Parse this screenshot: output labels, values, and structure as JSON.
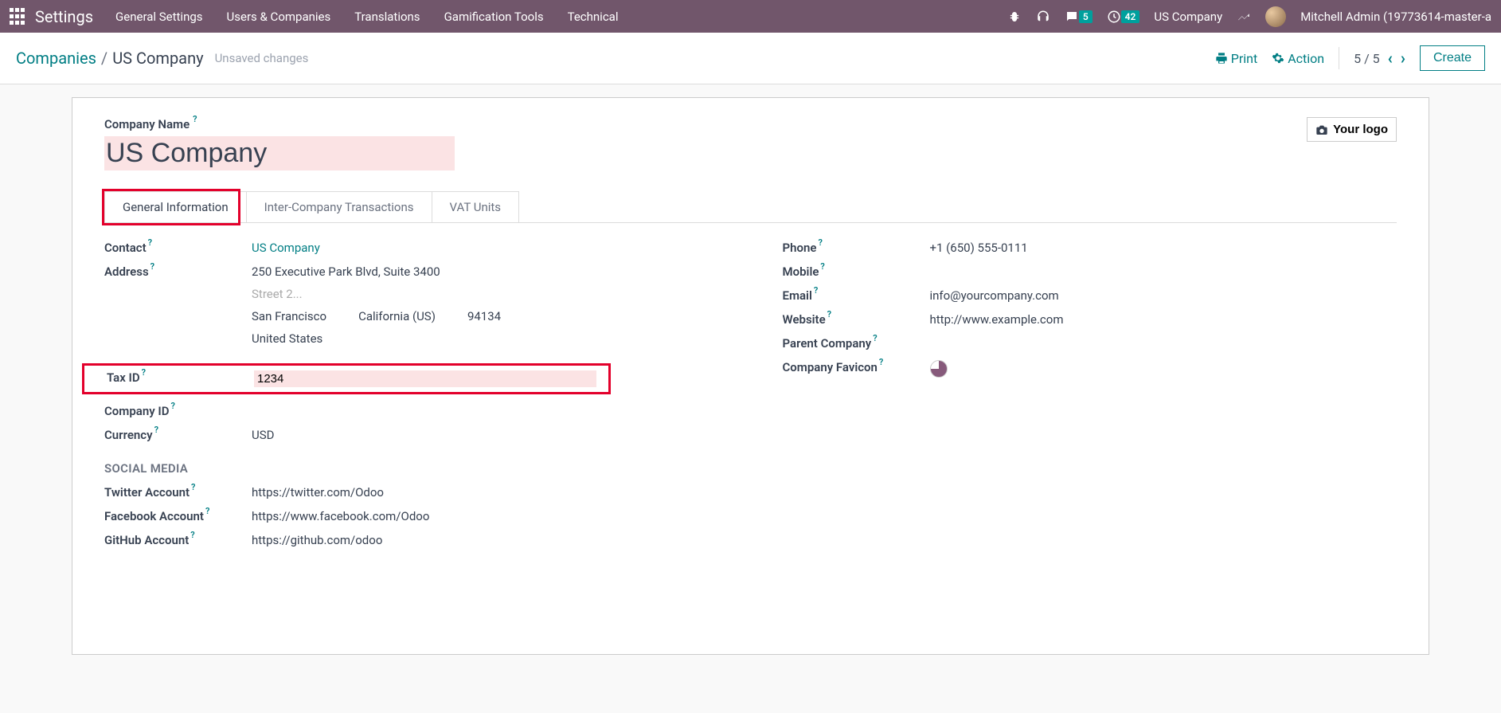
{
  "navbar": {
    "brand": "Settings",
    "menu": [
      "General Settings",
      "Users & Companies",
      "Translations",
      "Gamification Tools",
      "Technical"
    ],
    "msg_badge": "5",
    "clock_badge": "42",
    "company": "US Company",
    "user": "Mitchell Admin (19773614-master-a"
  },
  "controlbar": {
    "breadcrumb_root": "Companies",
    "breadcrumb_sep": "/",
    "breadcrumb_current": "US Company",
    "unsaved": "Unsaved changes",
    "print": "Print",
    "action": "Action",
    "pager": "5 / 5",
    "create": "Create"
  },
  "sheet": {
    "company_name_label": "Company Name",
    "company_name": "US Company",
    "logo_btn": "Your logo",
    "tabs": [
      "General Information",
      "Inter-Company Transactions",
      "VAT Units"
    ],
    "left": {
      "contact_lbl": "Contact",
      "contact_val": "US Company",
      "address_lbl": "Address",
      "street1": "250 Executive Park Blvd, Suite 3400",
      "street2_ph": "Street 2...",
      "city": "San Francisco",
      "state": "California (US)",
      "zip": "94134",
      "country": "United States",
      "taxid_lbl": "Tax ID",
      "taxid_val": "1234",
      "companyid_lbl": "Company ID",
      "currency_lbl": "Currency",
      "currency_val": "USD"
    },
    "right": {
      "phone_lbl": "Phone",
      "phone_val": "+1 (650) 555-0111",
      "mobile_lbl": "Mobile",
      "email_lbl": "Email",
      "email_val": "info@yourcompany.com",
      "website_lbl": "Website",
      "website_val": "http://www.example.com",
      "parent_lbl": "Parent Company",
      "favicon_lbl": "Company Favicon"
    },
    "social_title": "SOCIAL MEDIA",
    "social": {
      "twitter_lbl": "Twitter Account",
      "twitter_val": "https://twitter.com/Odoo",
      "facebook_lbl": "Facebook Account",
      "facebook_val": "https://www.facebook.com/Odoo",
      "github_lbl": "GitHub Account",
      "github_val": "https://github.com/odoo"
    }
  },
  "q": "?"
}
